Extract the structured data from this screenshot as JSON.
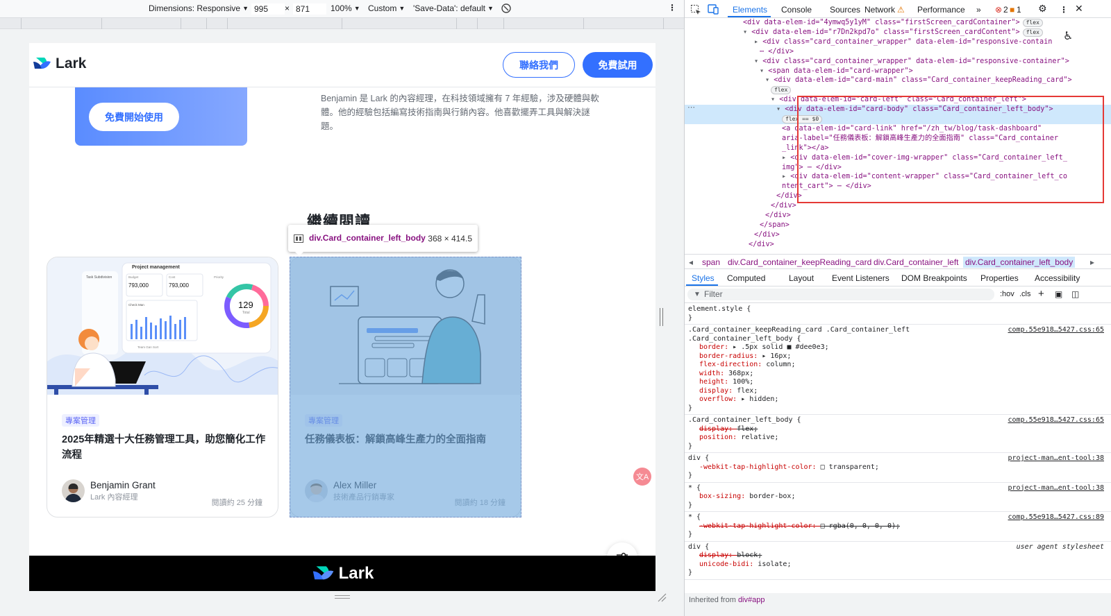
{
  "emulation_toolbar": {
    "dimensions_label": "Dimensions: Responsive",
    "width_value": "995",
    "times": "×",
    "height_value": "871",
    "zoom": "100%",
    "throttle": "Custom",
    "save_data": "'Save-Data': default"
  },
  "page": {
    "logo_text": "Lark",
    "contact_button": "聯絡我們",
    "trial_button": "免費試用",
    "banner_button": "免費開始使用",
    "bio_text": "Benjamin 是 Lark 的內容經理，在科技領域擁有 7 年經驗，涉及硬體與軟體。他的經驗包括編寫技術指南與行銷內容。他喜歡擺弄工具與解決謎題。",
    "section_title": "繼續閱讀",
    "cards": [
      {
        "tag": "專案管理",
        "title": "2025年精選十大任務管理工具，助您簡化工作流程",
        "author_name": "Benjamin Grant",
        "author_role": "Lark 內容經理",
        "read_time": "閱讀約 25 分鐘",
        "illustration": {
          "panel_title": "Project management",
          "task_label": "Task Subdivision",
          "stat_budget": "Budget",
          "stat_budget_value": "793,000",
          "stat_cost": "Cost",
          "stat_cost_value": "793,000",
          "stat_priority": "Priority",
          "donut_value": "129",
          "donut_label": "Total",
          "check_label": "Check Man",
          "team_label": "Team Gan Sort"
        }
      },
      {
        "tag": "專案管理",
        "title": "任務儀表板：解鎖高峰生產力的全面指南",
        "author_name": "Alex Miller",
        "author_role": "技術產品行銷專家",
        "read_time": "閱讀約 18 分鐘"
      }
    ],
    "footer_logo": "Lark"
  },
  "inspect_tooltip": {
    "name": "div.Card_container_left_body",
    "size": "368 × 414.5"
  },
  "devtools": {
    "tabs": [
      "Elements",
      "Console",
      "Sources",
      "Network",
      "Performance",
      "»"
    ],
    "error_count": "2",
    "warning_count": "1",
    "dom_lines": [
      {
        "indent": 8,
        "arrow": "",
        "html": "<div data-elem-id=\"4ymwq5y1yM\" class=\"firstScreen_cardContainer\">",
        "pill": "flex"
      },
      {
        "indent": 8,
        "arrow": "▾",
        "html": "<div data-elem-id=\"r7Dn2kpd7o\" class=\"firstScreen_cardContent\">",
        "pill": "flex"
      },
      {
        "indent": 10,
        "arrow": "▸",
        "html": "<div class=\"card_container_wrapper\" data-elem-id=\"responsive-contain",
        "pill": ""
      },
      {
        "indent": 11,
        "arrow": "",
        "html": "⋯ </div>",
        "pill": ""
      },
      {
        "indent": 10,
        "arrow": "▾",
        "html": "<div class=\"card_container_wrapper\" data-elem-id=\"responsive-container\">",
        "pill": ""
      },
      {
        "indent": 11,
        "arrow": "▾",
        "html": "<span data-elem-id=\"card-wrapper\">",
        "pill": ""
      },
      {
        "indent": 12,
        "arrow": "▾",
        "html": "<div data-elem-id=\"card-main\" class=\"Card_container_keepReading_card\">",
        "pill": ""
      },
      {
        "indent": 13,
        "arrow": "",
        "html": "flex",
        "pill": "tag"
      },
      {
        "indent": 13,
        "arrow": "▾",
        "html": "<div data-elem-id=\"card-left\" class=\"Card_container_left\">",
        "pill": ""
      },
      {
        "indent": 14,
        "arrow": "▾",
        "html": "<div data-elem-id=\"card-body\" class=\"Card_container_left_body\">",
        "pill": "",
        "selected": true
      },
      {
        "indent": 15,
        "arrow": "",
        "html": "flex  == $0",
        "pill": "tag",
        "selected": true
      },
      {
        "indent": 15,
        "arrow": "",
        "html": "<a data-elem-id=\"card-link\" href=\"/zh_tw/blog/task-dashboard\"",
        "pill": ""
      },
      {
        "indent": 15,
        "arrow": "",
        "html": "aria-label=\"任務儀表板：解鎖高峰生產力的全面指南\" class=\"Card_container",
        "pill": ""
      },
      {
        "indent": 15,
        "arrow": "",
        "html": "_link\"></a>",
        "pill": ""
      },
      {
        "indent": 15,
        "arrow": "▸",
        "html": "<div data-elem-id=\"cover-img-wrapper\" class=\"Card_container_left_",
        "pill": ""
      },
      {
        "indent": 15,
        "arrow": "",
        "html": "img\"> ⋯ </div>",
        "pill": ""
      },
      {
        "indent": 15,
        "arrow": "▸",
        "html": "<div data-elem-id=\"content-wrapper\" class=\"Card_container_left_co",
        "pill": ""
      },
      {
        "indent": 15,
        "arrow": "",
        "html": "ntent_cart\"> ⋯ </div>",
        "pill": ""
      },
      {
        "indent": 14,
        "arrow": "",
        "html": "</div>",
        "pill": ""
      },
      {
        "indent": 13,
        "arrow": "",
        "html": "</div>",
        "pill": ""
      },
      {
        "indent": 12,
        "arrow": "",
        "html": "</div>",
        "pill": ""
      },
      {
        "indent": 11,
        "arrow": "",
        "html": "</span>",
        "pill": ""
      },
      {
        "indent": 10,
        "arrow": "",
        "html": "</div>",
        "pill": ""
      },
      {
        "indent": 9,
        "arrow": "",
        "html": "</div>",
        "pill": ""
      }
    ],
    "breadcrumbs": [
      "span",
      "div.Card_container_keepReading_card",
      "div.Card_container_left",
      "div.Card_container_left_body"
    ],
    "subtabs": [
      "Styles",
      "Computed",
      "Layout",
      "Event Listeners",
      "DOM Breakpoints",
      "Properties",
      "Accessibility"
    ],
    "filter_placeholder": "Filter",
    "filter_hov": ":hov",
    "filter_cls": ".cls",
    "style_lines": [
      {
        "text": "element.style {",
        "kind": "sel"
      },
      {
        "text": "}",
        "kind": "sel"
      },
      {
        "text": ".Card_container_keepReading_card .Card_container_left",
        "kind": "sel",
        "src": "comp.55e918…5427.css:65"
      },
      {
        "text": ".Card_container_left_body {",
        "kind": "sel"
      },
      {
        "prop": "border",
        "val": "▸ .5px solid ■ #dee0e3;"
      },
      {
        "prop": "border-radius",
        "val": "▸ 16px;"
      },
      {
        "prop": "flex-direction",
        "val": "column;"
      },
      {
        "prop": "width",
        "val": "368px;"
      },
      {
        "prop": "height",
        "val": "100%;"
      },
      {
        "prop": "display",
        "val": "flex;"
      },
      {
        "prop": "overflow",
        "val": "▸ hidden;"
      },
      {
        "text": "}",
        "kind": "sel"
      },
      {
        "text": ".Card_container_left_body {",
        "kind": "sel",
        "src": "comp.55e918…5427.css:65"
      },
      {
        "prop": "display",
        "val": "flex;",
        "strike": true
      },
      {
        "prop": "position",
        "val": "relative;"
      },
      {
        "text": "}",
        "kind": "sel"
      },
      {
        "text": "div {",
        "kind": "sel",
        "src": "project-man…ent-tool:38"
      },
      {
        "prop": "-webkit-tap-highlight-color",
        "val": "□ transparent;"
      },
      {
        "text": "}",
        "kind": "sel"
      },
      {
        "text": "* {",
        "kind": "sel",
        "src": "project-man…ent-tool:38"
      },
      {
        "prop": "box-sizing",
        "val": "border-box;"
      },
      {
        "text": "}",
        "kind": "sel"
      },
      {
        "text": "* {",
        "kind": "sel",
        "src": "comp.55e918…5427.css:89"
      },
      {
        "prop": "-webkit-tap-highlight-color",
        "val": "□ rgba(0, 0, 0, 0);",
        "strike": true
      },
      {
        "text": "}",
        "kind": "sel"
      },
      {
        "text": "div {",
        "kind": "sel",
        "src": "user agent stylesheet",
        "plain": true
      },
      {
        "prop": "display",
        "val": "block;",
        "strike": true
      },
      {
        "prop": "unicode-bidi",
        "val": "isolate;"
      },
      {
        "text": "}",
        "kind": "sel"
      }
    ],
    "inherited_label": "Inherited from",
    "inherited_target": "div#app"
  }
}
